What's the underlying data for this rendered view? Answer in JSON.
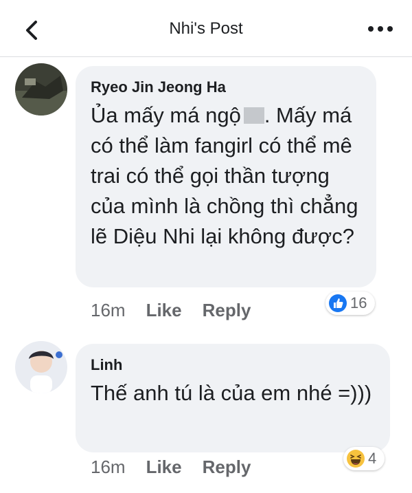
{
  "header": {
    "title": "Nhi's Post",
    "back_icon": "chevron-left-icon",
    "more_icon": "more-dots-icon"
  },
  "comments": [
    {
      "author": "Ryeo Jin Jeong Ha",
      "text_before": "Ủa mấy má ngộ",
      "text_after": ". Mấy má có thể làm fangirl có thể mê trai có thể gọi thần tượng của mình là chồng thì chẳng lẽ Diệu Nhi lại không được?",
      "time": "16m",
      "like_label": "Like",
      "reply_label": "Reply",
      "reaction_icon": "like-reaction-icon",
      "reaction_count": "16"
    },
    {
      "author": "Linh",
      "text": "Thế anh tú là của em nhé =)))",
      "time": "16m",
      "like_label": "Like",
      "reply_label": "Reply",
      "reaction_icon": "haha-reaction-icon",
      "reaction_count": "4"
    }
  ],
  "colors": {
    "bubble": "#f0f2f5",
    "meta_text": "#65676b",
    "like_blue": "#1877f2",
    "haha_yellow": "#f7c23e"
  }
}
